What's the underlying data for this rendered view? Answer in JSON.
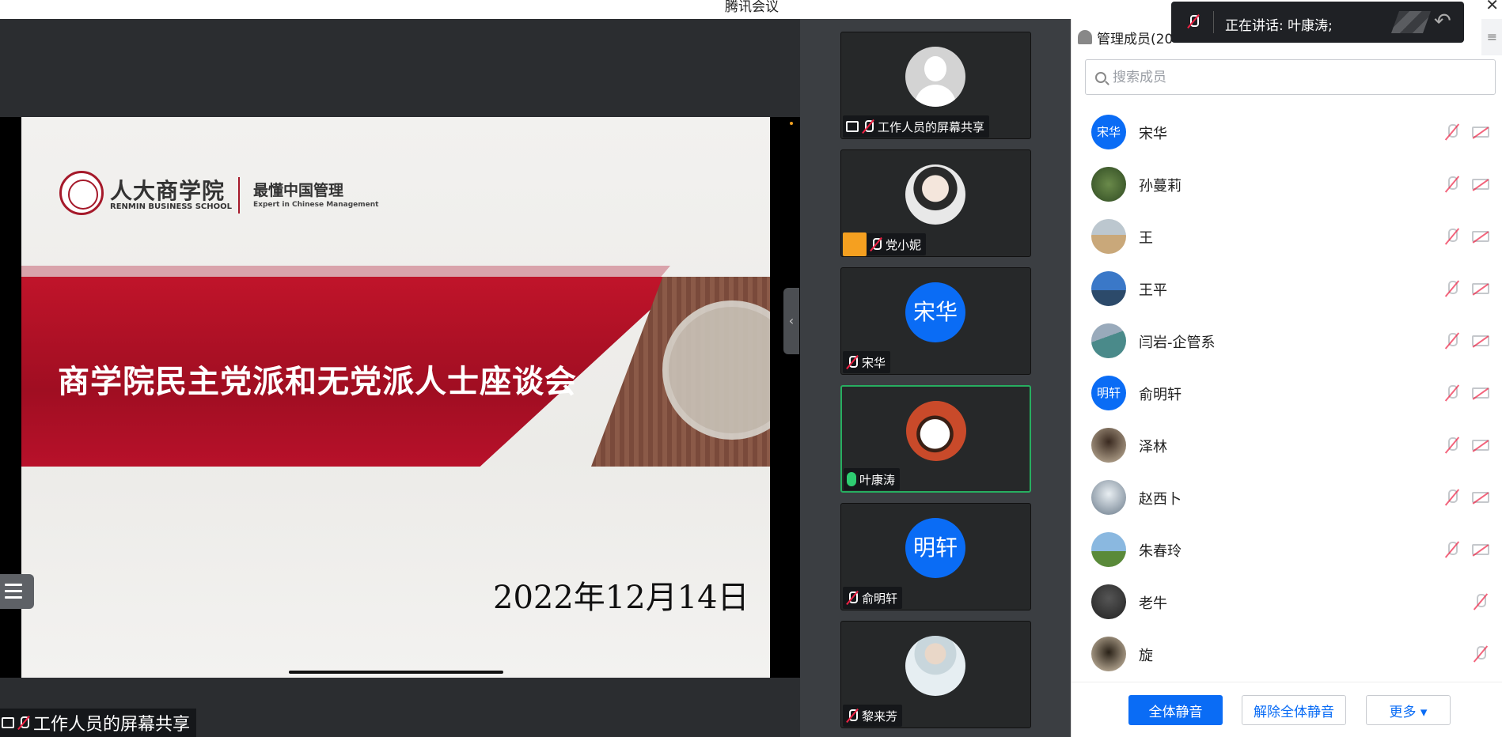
{
  "app": {
    "title": "腾讯会议"
  },
  "slide": {
    "logo_cn": "人大商学院",
    "logo_en": "RENMIN BUSINESS SCHOOL",
    "tagline_cn": "最懂中国管理",
    "tagline_en": "Expert in Chinese Management",
    "headline": "商学院民主党派和无党派人士座谈会",
    "date": "2022年12月14日"
  },
  "share_label": "工作人员的屏幕共享",
  "video_tiles": [
    {
      "name": "工作人员的屏幕共享",
      "avatar": "default-avatar",
      "mic": "muted"
    },
    {
      "name": "党小妮",
      "avatar": "photo",
      "mic": "muted"
    },
    {
      "name": "宋华",
      "avatar_text": "宋华",
      "mic": "muted"
    },
    {
      "name": "叶康涛",
      "avatar": "photo",
      "mic": "on"
    },
    {
      "name": "俞明轩",
      "avatar_text": "明轩",
      "mic": "muted"
    },
    {
      "name": "黎来芳",
      "avatar": "photo",
      "mic": "muted"
    }
  ],
  "panel": {
    "header": "管理成员(20",
    "search_placeholder": "搜索成员",
    "members": [
      {
        "name": "宋华",
        "avatar_text": "宋华"
      },
      {
        "name": "孙蔓莉"
      },
      {
        "name": "王"
      },
      {
        "name": "王平"
      },
      {
        "name": "闫岩-企管系"
      },
      {
        "name": "俞明轩",
        "avatar_text": "明轩"
      },
      {
        "name": "泽林"
      },
      {
        "name": "赵西卜"
      },
      {
        "name": "朱春玲"
      },
      {
        "name": "老牛"
      },
      {
        "name": "旋"
      }
    ],
    "buttons": {
      "mute_all": "全体静音",
      "unmute_all": "解除全体静音",
      "more": "更多 ▾"
    }
  },
  "toast": {
    "text": "正在讲话: 叶康涛;"
  },
  "colors": {
    "accent": "#0a6cf5",
    "speaking": "#27ae60",
    "slide_red": "#b0102a"
  }
}
